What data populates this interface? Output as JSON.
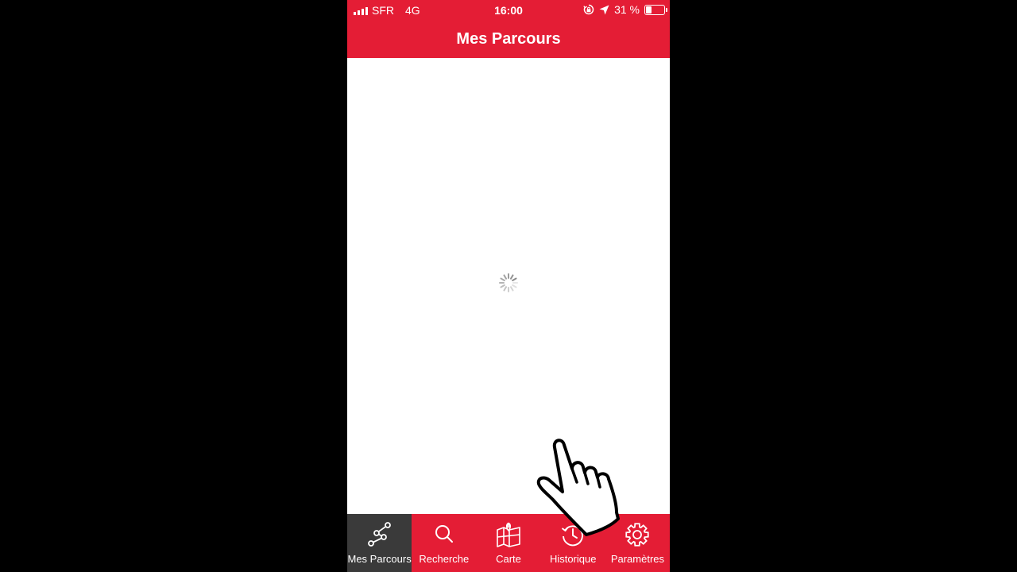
{
  "status_bar": {
    "carrier": "SFR",
    "network": "4G",
    "time": "16:00",
    "battery_percent": "31 %",
    "battery_level": 0.31,
    "icons": [
      "signal-icon",
      "rotation-lock-icon",
      "location-arrow-icon",
      "battery-icon"
    ]
  },
  "header": {
    "title": "Mes Parcours"
  },
  "content": {
    "state_icon": "loading-spinner-icon"
  },
  "tab_bar": {
    "tabs": [
      {
        "label": "Mes Parcours",
        "icon": "route-icon",
        "active": true
      },
      {
        "label": "Recherche",
        "icon": "search-icon",
        "active": false
      },
      {
        "label": "Carte",
        "icon": "map-icon",
        "active": false
      },
      {
        "label": "Historique",
        "icon": "history-icon",
        "active": false
      },
      {
        "label": "Paramètres",
        "icon": "gear-icon",
        "active": false
      }
    ]
  },
  "overlay": {
    "icon": "hand-pointer-icon"
  },
  "colors": {
    "brand_red": "#e41d35",
    "active_tab": "#3a3a3a",
    "background": "#000000",
    "content_background": "#ffffff"
  }
}
